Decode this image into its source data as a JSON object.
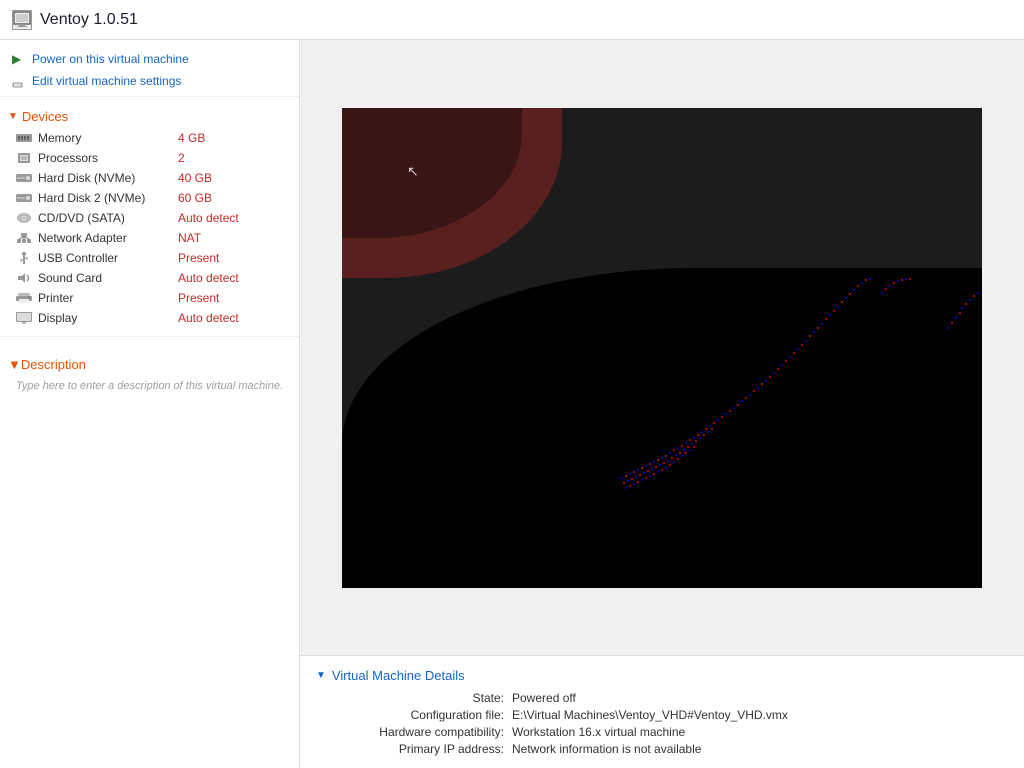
{
  "titleBar": {
    "icon": "VM",
    "title": "Ventoy 1.0.51"
  },
  "actions": [
    {
      "id": "power-on",
      "label": "Power on this virtual machine",
      "icon": "▶"
    },
    {
      "id": "edit-settings",
      "label": "Edit virtual machine settings",
      "icon": "✎"
    }
  ],
  "devices": {
    "sectionLabel": "Devices",
    "items": [
      {
        "name": "Memory",
        "value": "4 GB",
        "iconType": "memory"
      },
      {
        "name": "Processors",
        "value": "2",
        "iconType": "cpu"
      },
      {
        "name": "Hard Disk (NVMe)",
        "value": "40 GB",
        "iconType": "hdd"
      },
      {
        "name": "Hard Disk 2 (NVMe)",
        "value": "60 GB",
        "iconType": "hdd"
      },
      {
        "name": "CD/DVD (SATA)",
        "value": "Auto detect",
        "iconType": "cd"
      },
      {
        "name": "Network Adapter",
        "value": "NAT",
        "iconType": "net"
      },
      {
        "name": "USB Controller",
        "value": "Present",
        "iconType": "usb"
      },
      {
        "name": "Sound Card",
        "value": "Auto detect",
        "iconType": "sound"
      },
      {
        "name": "Printer",
        "value": "Present",
        "iconType": "print"
      },
      {
        "name": "Display",
        "value": "Auto detect",
        "iconType": "display"
      }
    ]
  },
  "description": {
    "sectionLabel": "Description",
    "placeholder": "Type here to enter a description of this virtual machine."
  },
  "vmDetails": {
    "sectionLabel": "Virtual Machine Details",
    "fields": [
      {
        "label": "State:",
        "value": "Powered off"
      },
      {
        "label": "Configuration file:",
        "value": "E:\\Virtual Machines\\Ventoy_VHD#Ventoy_VHD.vmx"
      },
      {
        "label": "Hardware compatibility:",
        "value": "Workstation 16.x virtual machine"
      },
      {
        "label": "Primary IP address:",
        "value": "Network information is not available"
      }
    ]
  }
}
